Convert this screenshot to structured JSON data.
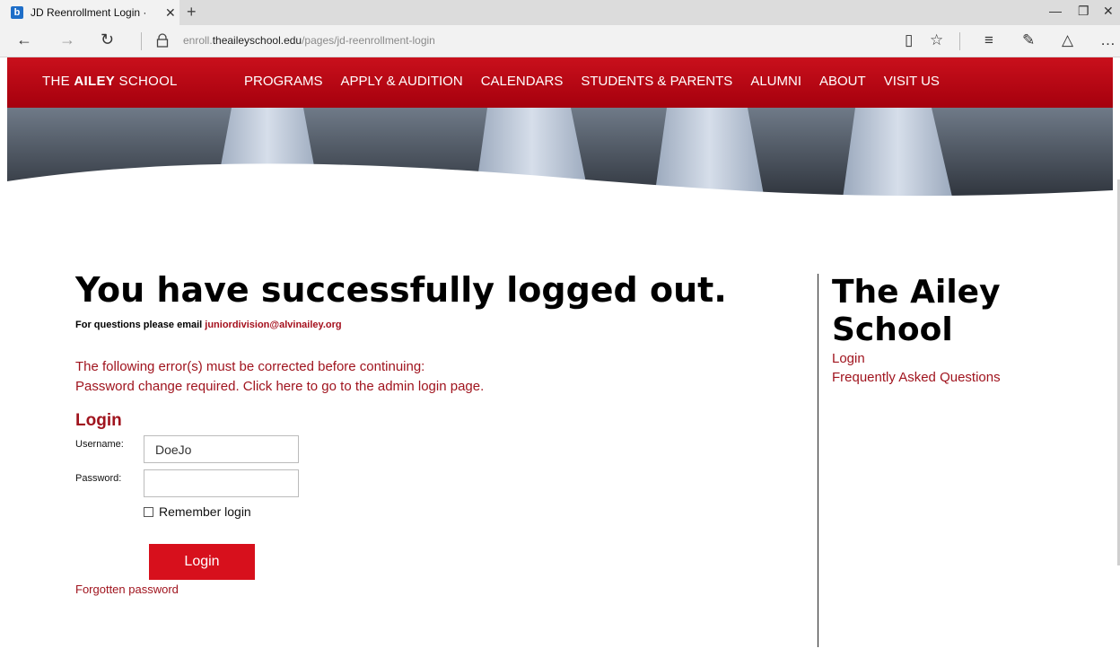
{
  "browser": {
    "tab_title": "JD Reenrollment Login ·",
    "tab_favicon": "b",
    "url_prefix": "enroll.",
    "url_domain": "theaileyschool.edu",
    "url_path": "/pages/jd-reenrollment-login"
  },
  "site": {
    "logo_pre": "THE ",
    "logo_bold": "AILEY",
    "logo_post": " SCHOOL",
    "nav": [
      "PROGRAMS",
      "APPLY & AUDITION",
      "CALENDARS",
      "STUDENTS & PARENTS",
      "ALUMNI",
      "ABOUT",
      "VISIT US"
    ],
    "brand_color": "#c9101c"
  },
  "main": {
    "headline": "You have successfully logged out.",
    "email_prefix": "For questions please email ",
    "email": "juniordivision@alvinailey.org",
    "error_intro": "The following error(s) must be corrected before continuing:",
    "error_detail": "Password change required. Click here to go to the admin login page.",
    "login_heading": "Login",
    "username_label": "Username:",
    "username_value": "DoeJo",
    "password_label": "Password:",
    "password_value": "",
    "remember_label": "Remember login",
    "login_button": "Login",
    "forgot_link": "Forgotten password"
  },
  "aside": {
    "title": "The Ailey School",
    "links": [
      "Login",
      "Frequently Asked Questions"
    ]
  }
}
